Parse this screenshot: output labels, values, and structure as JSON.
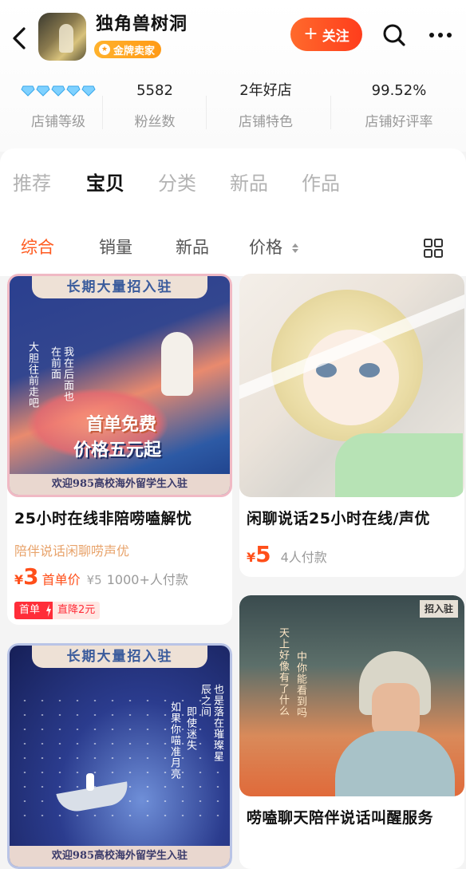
{
  "header": {
    "shop_name": "独角兽树洞",
    "badge": "金牌卖家",
    "follow_label": "关注",
    "follow_plus": "+"
  },
  "stats": [
    {
      "value": "",
      "label": "店铺等级",
      "diamonds": 5
    },
    {
      "value": "5582",
      "label": "粉丝数"
    },
    {
      "value": "2年好店",
      "label": "店铺特色"
    },
    {
      "value": "99.52%",
      "label": "店铺好评率"
    }
  ],
  "main_tabs": [
    "推荐",
    "宝贝",
    "分类",
    "新品",
    "作品"
  ],
  "active_main_tab": "宝贝",
  "sub_tabs": [
    "综合",
    "销量",
    "新品",
    "价格"
  ],
  "active_sub_tab": "综合",
  "products": [
    {
      "title": "25小时在线非陪唠嗑解忧",
      "tag": "陪伴说话闲聊唠声优",
      "currency": "¥",
      "price": "3",
      "price_tag": "首单价",
      "old_price": "¥5",
      "payers": "1000+人付款",
      "promo_label": "首单",
      "promo_discount": "直降2元",
      "poster": {
        "banner": "长期大量招入驻",
        "line1": "首单免费",
        "line2": "价格五元起",
        "vertical_left": "大胆往前走吧",
        "vertical_right": "我在后面也在前面",
        "footer": "欢迎985高校海外留学生入驻"
      }
    },
    {
      "title": "闲聊说话25小时在线/声优",
      "currency": "¥",
      "price": "5",
      "payers": "4人付款"
    },
    {
      "title": "",
      "poster": {
        "banner": "长期大量招入驻",
        "vertical_a": "也是落在璀璨星辰之间",
        "vertical_b": "即使迷失",
        "vertical_c": "如果你喵准月亮",
        "footer": "欢迎985高校海外留学生入驻"
      }
    },
    {
      "title": "唠嗑聊天陪伴说话叫醒服务",
      "poster": {
        "corner": "招入驻",
        "vertical_a": "天上好像有了什么",
        "vertical_b": "中你能看到吗"
      }
    }
  ],
  "colors": {
    "accent": "#ff5a1f",
    "price": "#ff4f1a",
    "badge": "#ff9a16"
  }
}
